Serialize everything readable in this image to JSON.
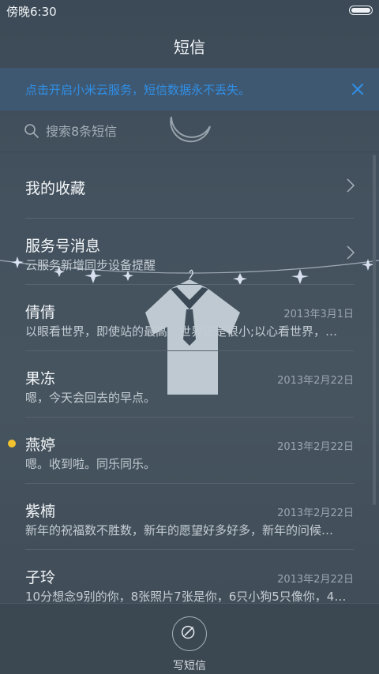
{
  "status": {
    "time": "傍晚6:30"
  },
  "header": {
    "title": "短信"
  },
  "banner": {
    "text": "点击开启小米云服务，短信数据永不丢失。"
  },
  "search": {
    "placeholder": "搜索8条短信"
  },
  "list": {
    "favorites": {
      "label": "我的收藏"
    },
    "service": {
      "label": "服务号消息",
      "preview": "云服务新增同步设备提醒"
    },
    "conversations": [
      {
        "name": "倩倩",
        "date": "2013年3月1日",
        "preview": "以眼看世界，即使站的最高，世界还是很小;以心看世界，…",
        "unread": false
      },
      {
        "name": "果冻",
        "date": "2013年2月22日",
        "preview": "嗯，今天会回去的早点。",
        "unread": false
      },
      {
        "name": "燕婷",
        "date": "2013年2月22日",
        "preview": "嗯。收到啦。同乐同乐。",
        "unread": true
      },
      {
        "name": "紫楠",
        "date": "2013年2月22日",
        "preview": "新年的祝福数不胜数，新年的愿望好多好多，新年的问候…",
        "unread": false
      },
      {
        "name": "子玲",
        "date": "2013年2月22日",
        "preview": "10分想念9别的你，8张照片7张是你，6只小狗5只像你，4…",
        "unread": false
      }
    ]
  },
  "footer": {
    "compose_label": "写短信"
  },
  "colors": {
    "banner_text": "#2f8fe6",
    "unread_dot": "#f2c12e",
    "background": "#44525f"
  },
  "icons": [
    "search-icon",
    "close-icon",
    "chevron-right-icon",
    "compose-icon"
  ]
}
